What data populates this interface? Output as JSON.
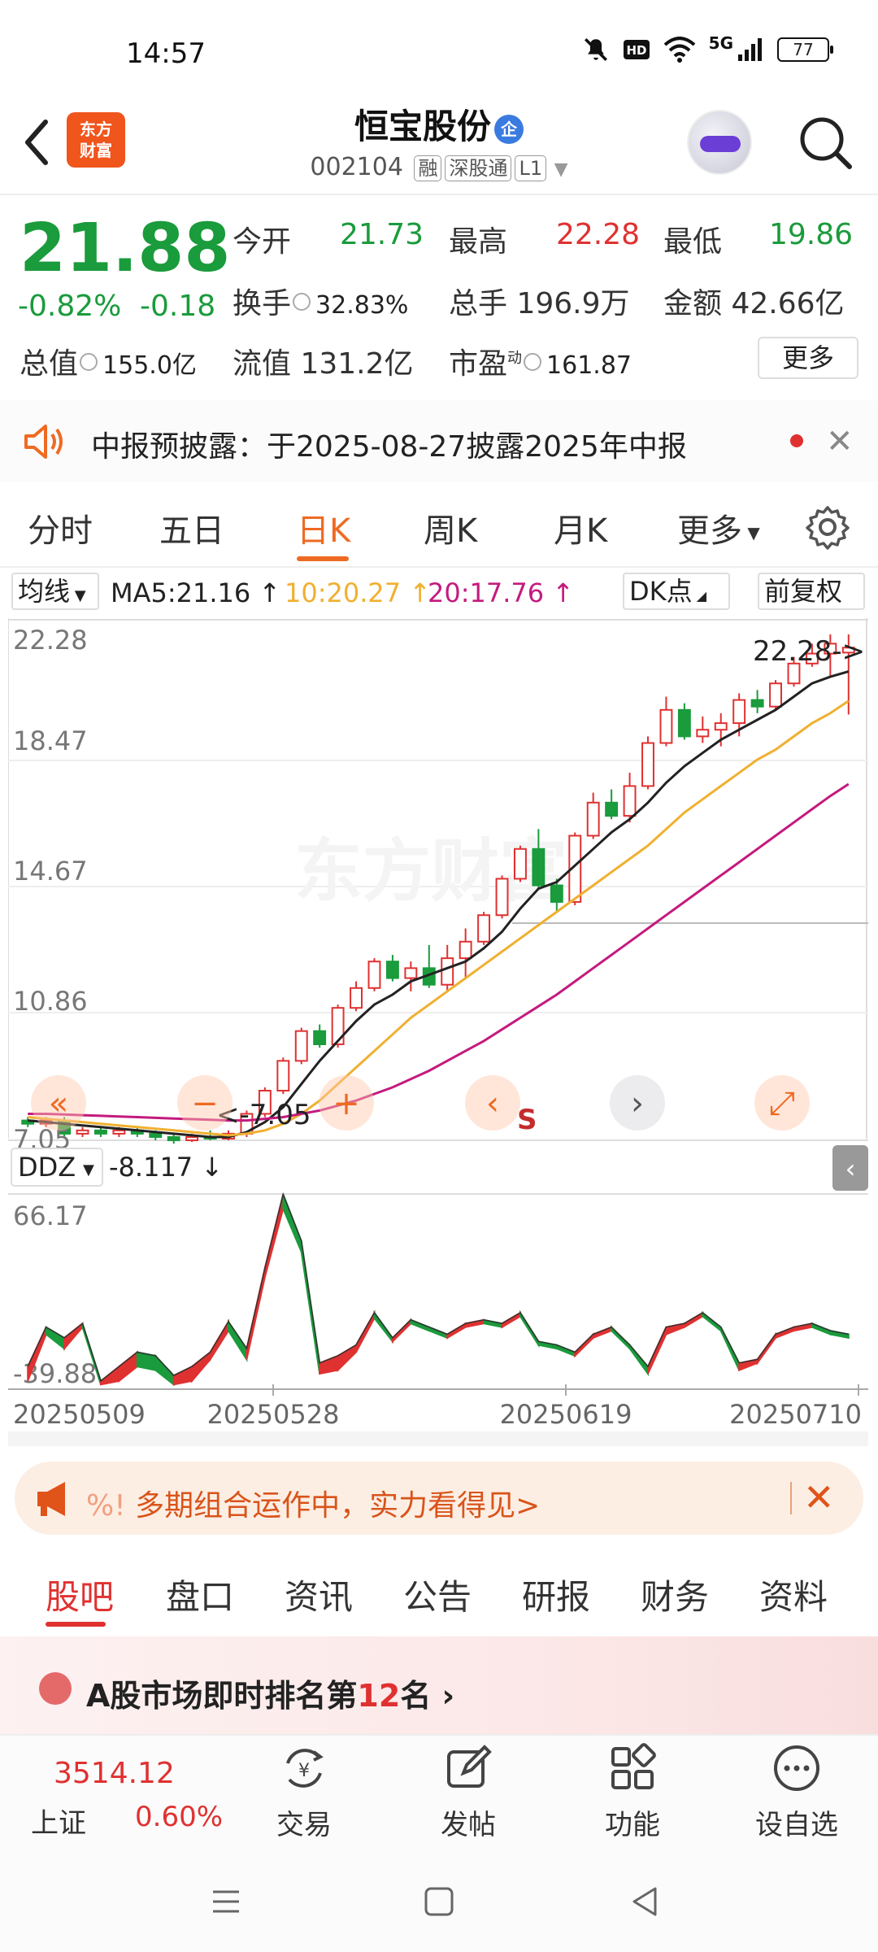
{
  "status": {
    "time": "14:57",
    "network": "5G",
    "battery": "77"
  },
  "header": {
    "logo_line1": "东方",
    "logo_line2": "财富",
    "stock_name": "恒宝股份",
    "name_badge": "企",
    "stock_code": "002104",
    "tags": [
      "融",
      "深股通",
      "L1"
    ]
  },
  "quote": {
    "price": "21.88",
    "change_pct": "-0.82%",
    "change": "-0.18",
    "open_label": "今开",
    "open": "21.73",
    "high_label": "最高",
    "high": "22.28",
    "low_label": "最低",
    "low": "19.86",
    "turnover_label": "换手",
    "turnover": "32.83%",
    "volume_label": "总手",
    "volume": "196.9万",
    "amount_label": "金额",
    "amount": "42.66亿",
    "mktcap_label": "总值",
    "mktcap": "155.0亿",
    "float_label": "流值",
    "float_cap": "131.2亿",
    "pe_label": "市盈",
    "pe_sup": "动",
    "pe": "161.87",
    "more": "更多"
  },
  "notice": {
    "text": "中报预披露：于2025-08-27披露2025年中报"
  },
  "period_tabs": [
    "分时",
    "五日",
    "日K",
    "周K",
    "月K",
    "更多"
  ],
  "active_period": "日K",
  "indicators": {
    "type_label": "均线",
    "ma5": "MA5:21.16",
    "ma10": "10:20.27",
    "ma20": "20:17.76",
    "dk_label": "DK点",
    "adjust_label": "前复权"
  },
  "colors": {
    "up": "#e03131",
    "down": "#1a9b3c",
    "ma5": "#222222",
    "ma10": "#f0b030",
    "ma20": "#c41a7e",
    "accent": "#ee6a23"
  },
  "chart_data": [
    {
      "type": "candlestick",
      "y_ticks": [
        "22.28",
        "18.47",
        "14.67",
        "10.86",
        "7.05"
      ],
      "ylim": [
        7.05,
        22.28
      ],
      "max_label": "22.28->",
      "min_label": "<-7.05",
      "signal_label": "S",
      "x_labels": [
        "20250509",
        "20250528",
        "20250619",
        "20250710"
      ],
      "candles": [
        [
          7.6,
          7.5,
          7.7,
          7.4
        ],
        [
          7.5,
          7.6,
          7.7,
          7.4
        ],
        [
          7.6,
          7.2,
          7.7,
          7.1
        ],
        [
          7.2,
          7.3,
          7.4,
          7.1
        ],
        [
          7.3,
          7.2,
          7.4,
          7.1
        ],
        [
          7.2,
          7.3,
          7.4,
          7.1
        ],
        [
          7.3,
          7.2,
          7.4,
          7.1
        ],
        [
          7.2,
          7.1,
          7.3,
          7.0
        ],
        [
          7.1,
          7.0,
          7.2,
          6.9
        ],
        [
          7.0,
          7.1,
          7.2,
          6.95
        ],
        [
          7.1,
          7.05,
          7.3,
          7.0
        ],
        [
          7.05,
          7.2,
          7.3,
          7.0
        ],
        [
          7.2,
          7.8,
          7.9,
          7.1
        ],
        [
          7.8,
          8.5,
          8.6,
          7.7
        ],
        [
          8.5,
          9.4,
          9.5,
          8.4
        ],
        [
          9.4,
          10.3,
          10.4,
          9.3
        ],
        [
          10.3,
          9.9,
          10.5,
          9.8
        ],
        [
          9.9,
          11.0,
          11.1,
          9.8
        ],
        [
          11.0,
          11.6,
          11.8,
          10.9
        ],
        [
          11.6,
          12.4,
          12.5,
          11.5
        ],
        [
          12.4,
          11.9,
          12.6,
          11.8
        ],
        [
          11.9,
          12.2,
          12.4,
          11.5
        ],
        [
          12.2,
          11.7,
          12.9,
          11.6
        ],
        [
          11.7,
          12.5,
          12.9,
          11.5
        ],
        [
          12.5,
          13.0,
          13.4,
          11.9
        ],
        [
          13.0,
          13.8,
          13.9,
          12.9
        ],
        [
          13.8,
          14.9,
          15.0,
          13.7
        ],
        [
          14.9,
          15.8,
          15.9,
          14.8
        ],
        [
          15.8,
          14.7,
          16.4,
          14.6
        ],
        [
          14.7,
          14.2,
          14.9,
          13.9
        ],
        [
          14.2,
          16.2,
          16.3,
          14.1
        ],
        [
          16.2,
          17.2,
          17.5,
          16.1
        ],
        [
          17.2,
          16.8,
          17.6,
          16.7
        ],
        [
          16.8,
          17.7,
          18.1,
          16.6
        ],
        [
          17.7,
          19.0,
          19.2,
          17.6
        ],
        [
          19.0,
          20.0,
          20.4,
          18.9
        ],
        [
          20.0,
          19.2,
          20.2,
          19.1
        ],
        [
          19.2,
          19.4,
          19.8,
          19.0
        ],
        [
          19.4,
          19.6,
          19.9,
          18.9
        ],
        [
          19.6,
          20.3,
          20.5,
          19.2
        ],
        [
          20.3,
          20.1,
          20.6,
          19.9
        ],
        [
          20.1,
          20.8,
          20.9,
          20.0
        ],
        [
          20.8,
          21.4,
          21.6,
          20.7
        ],
        [
          21.4,
          21.7,
          22.0,
          21.3
        ],
        [
          21.7,
          22.0,
          22.28,
          21.0
        ],
        [
          21.73,
          21.88,
          22.28,
          19.86
        ]
      ],
      "ma5": [
        7.6,
        7.55,
        7.5,
        7.45,
        7.4,
        7.35,
        7.3,
        7.25,
        7.2,
        7.15,
        7.1,
        7.1,
        7.25,
        7.55,
        8.0,
        8.7,
        9.4,
        10.0,
        10.6,
        11.1,
        11.4,
        11.8,
        12.0,
        12.2,
        12.4,
        12.8,
        13.3,
        14.0,
        14.6,
        14.8,
        15.3,
        15.8,
        16.3,
        16.7,
        17.2,
        17.8,
        18.3,
        18.7,
        19.1,
        19.4,
        19.7,
        20.0,
        20.4,
        20.8,
        21.0,
        21.16
      ],
      "ma10": [
        7.7,
        7.65,
        7.6,
        7.55,
        7.5,
        7.45,
        7.4,
        7.35,
        7.3,
        7.25,
        7.2,
        7.15,
        7.2,
        7.3,
        7.5,
        7.8,
        8.2,
        8.7,
        9.2,
        9.7,
        10.2,
        10.7,
        11.1,
        11.5,
        11.9,
        12.3,
        12.7,
        13.1,
        13.5,
        13.9,
        14.3,
        14.7,
        15.1,
        15.5,
        15.9,
        16.4,
        16.9,
        17.3,
        17.7,
        18.1,
        18.5,
        18.8,
        19.2,
        19.6,
        19.9,
        20.27
      ],
      "ma20": [
        7.8,
        7.8,
        7.78,
        7.76,
        7.74,
        7.72,
        7.7,
        7.68,
        7.66,
        7.64,
        7.62,
        7.6,
        7.6,
        7.65,
        7.7,
        7.8,
        7.9,
        8.05,
        8.2,
        8.4,
        8.6,
        8.85,
        9.1,
        9.4,
        9.7,
        10.0,
        10.35,
        10.7,
        11.05,
        11.4,
        11.8,
        12.2,
        12.6,
        13.0,
        13.4,
        13.8,
        14.2,
        14.6,
        15.0,
        15.4,
        15.8,
        16.2,
        16.6,
        17.0,
        17.4,
        17.76
      ]
    },
    {
      "type": "area",
      "indicator_label": "DDZ",
      "value": "-8.117",
      "y_ticks": [
        "66.17",
        "-39.88"
      ],
      "ylim": [
        -39.88,
        66.17
      ],
      "upper": [
        -30,
        -8,
        -14,
        -6,
        -38,
        -30,
        -22,
        -24,
        -35,
        -30,
        -22,
        -5,
        -20,
        25,
        66,
        40,
        -28,
        -24,
        -18,
        0,
        -14,
        -4,
        -8,
        -12,
        -6,
        -4,
        -6,
        0,
        -16,
        -18,
        -22,
        -12,
        -8,
        -18,
        -30,
        -8,
        -6,
        0,
        -8,
        -28,
        -26,
        -12,
        -8,
        -6,
        -10,
        -12
      ],
      "lower": [
        -38,
        -12,
        -20,
        -8,
        -40,
        -38,
        -30,
        -32,
        -40,
        -38,
        -26,
        -10,
        -26,
        20,
        58,
        34,
        -34,
        -32,
        -22,
        -3,
        -16,
        -6,
        -10,
        -14,
        -8,
        -6,
        -8,
        -2,
        -18,
        -20,
        -24,
        -14,
        -10,
        -20,
        -34,
        -12,
        -8,
        -2,
        -10,
        -32,
        -28,
        -14,
        -10,
        -8,
        -12,
        -14
      ]
    }
  ],
  "ad": {
    "icon_text": "%!",
    "text": "多期组合运作中，实力看得见>"
  },
  "bottom_tabs": [
    "股吧",
    "盘口",
    "资讯",
    "公告",
    "研报",
    "财务",
    "资料"
  ],
  "rank": {
    "prefix": "A股市场即时排名第",
    "rank": "12",
    "suffix": "名 ›"
  },
  "toolbar": {
    "index_value": "3514.12",
    "index_name": "上证",
    "index_pct": "0.60%",
    "items": [
      "交易",
      "发帖",
      "功能",
      "设自选"
    ]
  }
}
